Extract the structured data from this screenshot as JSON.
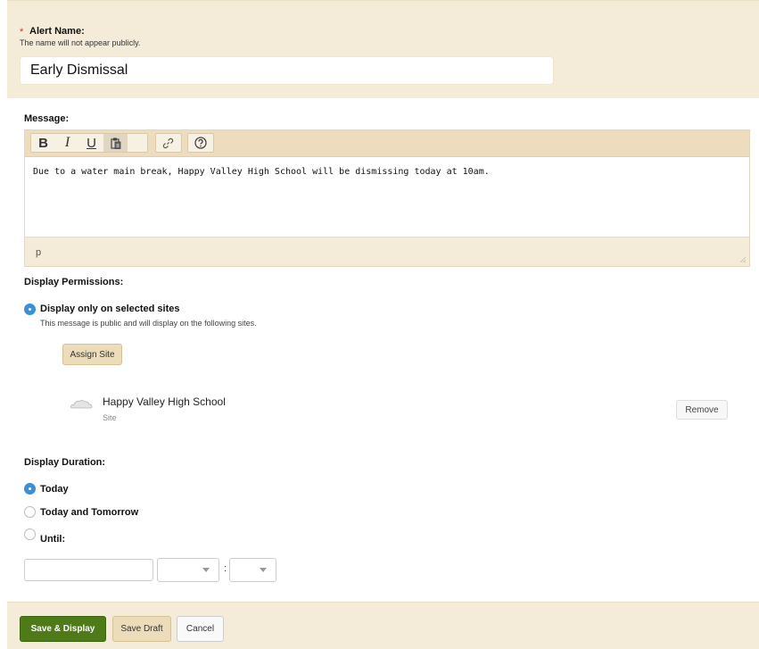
{
  "alert_name": {
    "required_mark": "*",
    "label": "Alert Name:",
    "help": "The name will not appear publicly.",
    "value": "Early Dismissal"
  },
  "message": {
    "label": "Message:",
    "toolbar": {
      "bold": "B",
      "italic": "I",
      "underline": "U",
      "paste_icon": "clipboard-paste-icon",
      "link_icon": "link-icon",
      "help_icon": "help-circle-icon"
    },
    "body": "Due to a water main break, Happy Valley High School will be dismissing today at 10am.",
    "path": "p"
  },
  "permissions": {
    "label": "Display Permissions:",
    "option_label": "Display only on selected sites",
    "option_help": "This message is public and will display on the following sites.",
    "assign_button": "Assign Site",
    "site": {
      "icon": "cloud-icon",
      "name": "Happy Valley High School",
      "type": "Site",
      "remove_button": "Remove"
    }
  },
  "duration": {
    "label": "Display Duration:",
    "options": [
      "Today",
      "Today and Tomorrow",
      "Until:"
    ],
    "selected": "Today",
    "time_separator": ":"
  },
  "footer": {
    "save_display": "Save & Display",
    "save_draft": "Save Draft",
    "cancel": "Cancel"
  },
  "colors": {
    "panel_bg": "#f4ecd9",
    "radio_selected": "#3a8fd9",
    "primary_button": "#4e7a17",
    "secondary_button": "#ecdcb9"
  }
}
